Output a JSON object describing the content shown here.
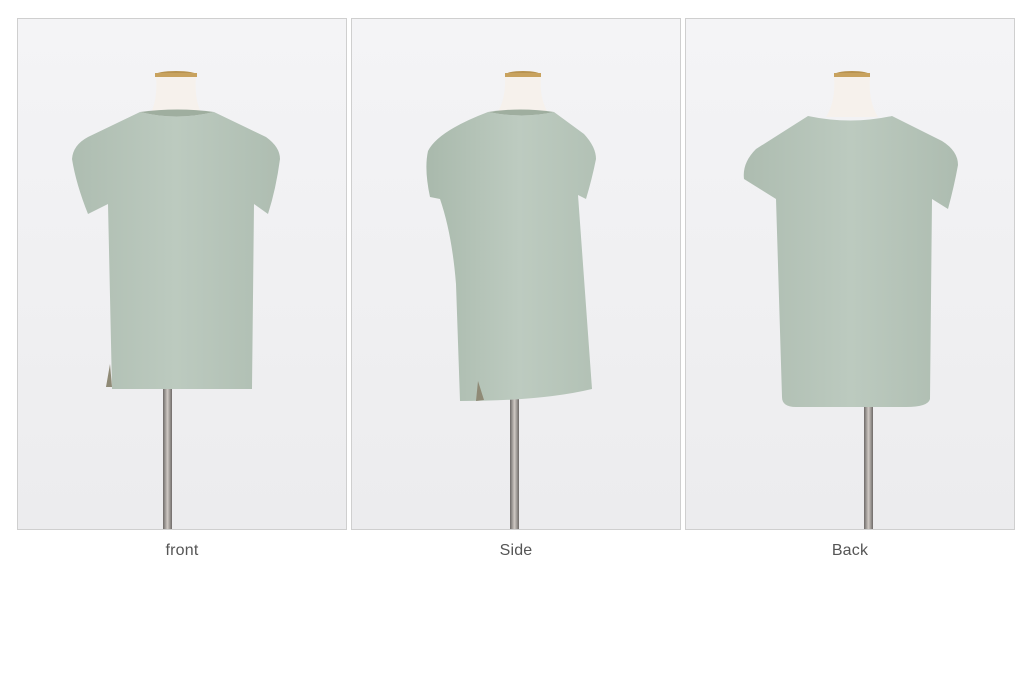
{
  "gallery": {
    "views": [
      {
        "caption": "front",
        "image_icon": "mannequin-front-icon"
      },
      {
        "caption": "Side",
        "image_icon": "mannequin-side-icon"
      },
      {
        "caption": "Back",
        "image_icon": "mannequin-back-icon"
      }
    ]
  },
  "colors": {
    "garment": "#b9c7bc",
    "garment_shadow": "#a8b8ab",
    "background": "#f2f2f4",
    "frame_border": "#cfcfcf",
    "caption_text": "#555555"
  }
}
